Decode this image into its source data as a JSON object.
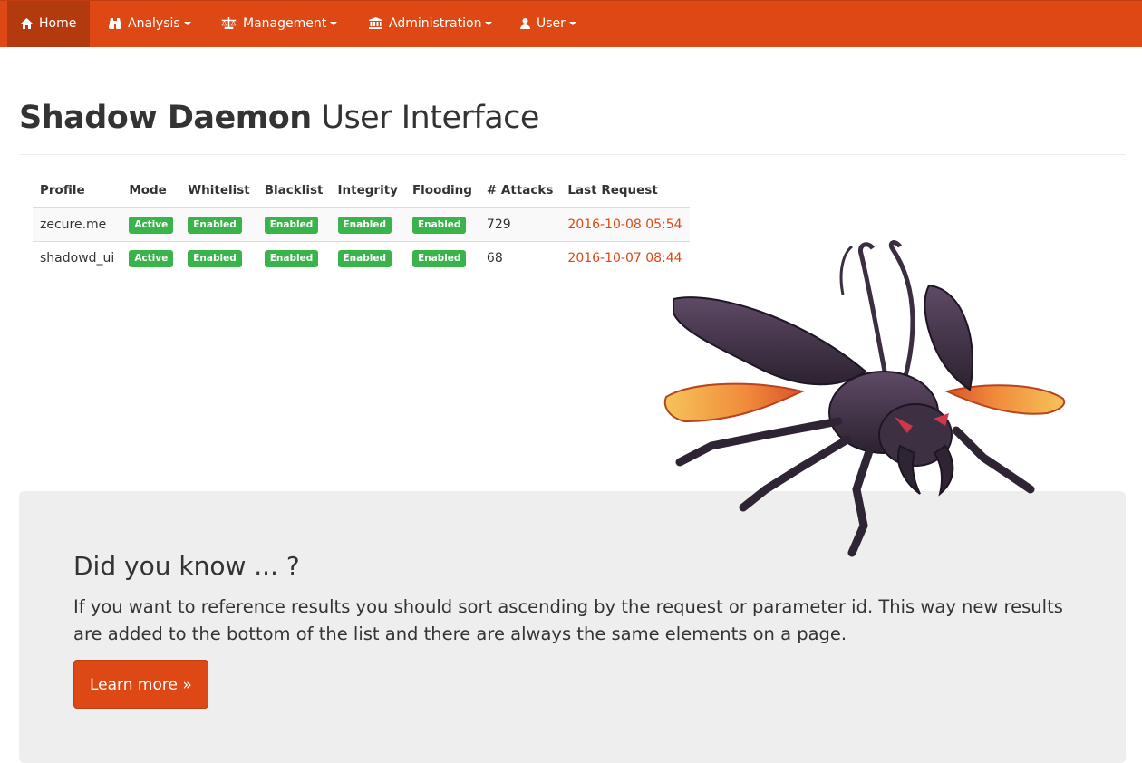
{
  "navbar": {
    "items": [
      {
        "label": "Home",
        "icon": "home-icon",
        "active": true
      },
      {
        "label": "Analysis",
        "icon": "binoculars-icon",
        "dropdown": true
      },
      {
        "label": "Management",
        "icon": "scale-icon",
        "dropdown": true
      },
      {
        "label": "Administration",
        "icon": "bank-icon",
        "dropdown": true
      },
      {
        "label": "User",
        "icon": "user-icon",
        "dropdown": true
      }
    ]
  },
  "header": {
    "title_bold": "Shadow Daemon",
    "title_rest": " User Interface"
  },
  "table": {
    "columns": [
      "Profile",
      "Mode",
      "Whitelist",
      "Blacklist",
      "Integrity",
      "Flooding",
      "# Attacks",
      "Last Request"
    ],
    "rows": [
      {
        "profile": "zecure.me",
        "mode": "Active",
        "whitelist": "Enabled",
        "blacklist": "Enabled",
        "integrity": "Enabled",
        "flooding": "Enabled",
        "attacks": "729",
        "last_request": "2016-10-08 05:54"
      },
      {
        "profile": "shadowd_ui",
        "mode": "Active",
        "whitelist": "Enabled",
        "blacklist": "Enabled",
        "integrity": "Enabled",
        "flooding": "Enabled",
        "attacks": "68",
        "last_request": "2016-10-07 08:44"
      }
    ]
  },
  "jumbotron": {
    "title": "Did you know ... ?",
    "text": "If you want to reference results you should sort ascending by the request or parameter id. This way new results are added to the bottom of the list and there are always the same elements on a page.",
    "button_label": "Learn more »"
  },
  "colors": {
    "brand": "#dd4814",
    "active_nav": "#b33a0f",
    "label_green": "#38b44a",
    "jumbotron_bg": "#eeeeee"
  }
}
